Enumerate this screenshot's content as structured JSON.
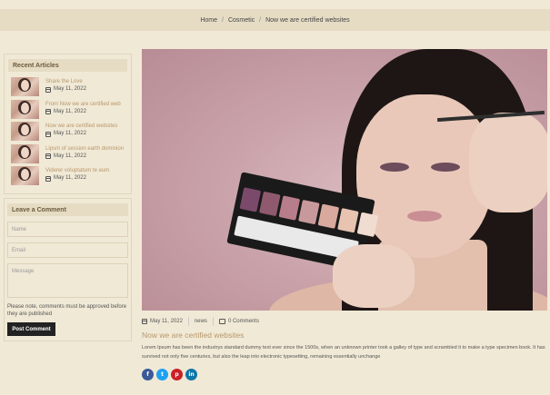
{
  "breadcrumb": {
    "items": [
      "Home",
      "Cosmetic",
      "Now we are certified websites"
    ]
  },
  "sidebar": {
    "recent_title": "Recent Articles",
    "articles": [
      {
        "title": "Share the Love",
        "date": "May 11, 2022"
      },
      {
        "title": "From Now we are certified web",
        "date": "May 11, 2022"
      },
      {
        "title": "Now we are certified websites",
        "date": "May 11, 2022"
      },
      {
        "title": "Lipsm of session earth dominion",
        "date": "May 11, 2022"
      },
      {
        "title": "Viderer voluptatum te eum",
        "date": "May 11, 2022"
      }
    ],
    "comment": {
      "title": "Leave a Comment",
      "name_placeholder": "Name",
      "email_placeholder": "Email",
      "message_placeholder": "Message",
      "note": "Please note, comments must be approved before they are published",
      "button": "Post Comment"
    }
  },
  "post": {
    "date": "May 11, 2022",
    "tag": "news",
    "comments": "0 Comments",
    "title": "Now we are certified websites",
    "excerpt": "Lorem Ipsum has been the industrys standard dummy text ever since the 1500s, when an unknown printer took a galley of type and scrambled it to make a type specimen book. It has survived not only five centuries, but also the leap into electronic typesetting, remaining essentially unchange"
  },
  "social": [
    {
      "icon": "facebook-icon",
      "glyph": "f",
      "color": "#3b5998"
    },
    {
      "icon": "twitter-icon",
      "glyph": "t",
      "color": "#1da1f2"
    },
    {
      "icon": "pinterest-icon",
      "glyph": "p",
      "color": "#cb2027"
    },
    {
      "icon": "linkedin-icon",
      "glyph": "in",
      "color": "#0e76a8"
    }
  ],
  "palette_colors": [
    "#7b4a6b",
    "#8f5a6e",
    "#b77d8a",
    "#c8999c",
    "#d8a99c",
    "#e7c3b0",
    "#f0dcd0"
  ]
}
